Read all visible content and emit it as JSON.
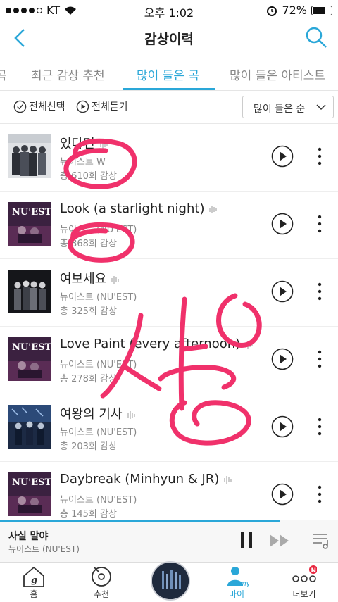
{
  "status_bar": {
    "carrier": "KT",
    "time": "오후 1:02",
    "battery_percent": "72%",
    "battery_level": 0.72
  },
  "header": {
    "title": "감상이력",
    "back_icon": "chevron-left-icon",
    "search_icon": "search-icon"
  },
  "tabs": [
    {
      "label": "곡",
      "active": false
    },
    {
      "label": "최근 감상 추천",
      "active": false
    },
    {
      "label": "많이 들은 곡",
      "active": true
    },
    {
      "label": "많이 들은 아티스트",
      "active": false
    }
  ],
  "toolbar": {
    "select_all": "전체선택",
    "play_all": "전체듣기",
    "sort": "많이 들은 순"
  },
  "songs": [
    {
      "title": "있다면",
      "artist": "뉴이스트 W",
      "count": "총 610회 감상"
    },
    {
      "title": "Look (a starlight night)",
      "artist": "뉴이스트 (NU'EST)",
      "count": "총 368회 감상"
    },
    {
      "title": "여보세요",
      "artist": "뉴이스트 (NU'EST)",
      "count": "총 325회 감상"
    },
    {
      "title": "Love Paint (every afternoon)",
      "artist": "뉴이스트 (NU'EST)",
      "count": "총 278회 감상"
    },
    {
      "title": "여왕의 기사",
      "artist": "뉴이스트 (NU'EST)",
      "count": "총 203회 감상"
    },
    {
      "title": "Daybreak (Minhyun & JR)",
      "artist": "뉴이스트 (NU'EST)",
      "count": "총 145회 감상"
    }
  ],
  "mini_player": {
    "title": "사실 말야",
    "artist": "뉴이스트 (NU'EST)",
    "progress": 0.83
  },
  "bottom_nav": [
    {
      "label": "홈",
      "icon": "home-icon"
    },
    {
      "label": "추천",
      "icon": "recommend-icon"
    },
    {
      "label": "",
      "icon": "now-playing-disc"
    },
    {
      "label": "마이",
      "icon": "my-person-icon",
      "active": true
    },
    {
      "label": "더보기",
      "icon": "more-dots-icon",
      "badge": "N"
    }
  ],
  "handwriting": {
    "text": "시상"
  },
  "colors": {
    "accent": "#2aa7d8",
    "scribble": "#f0316b"
  }
}
